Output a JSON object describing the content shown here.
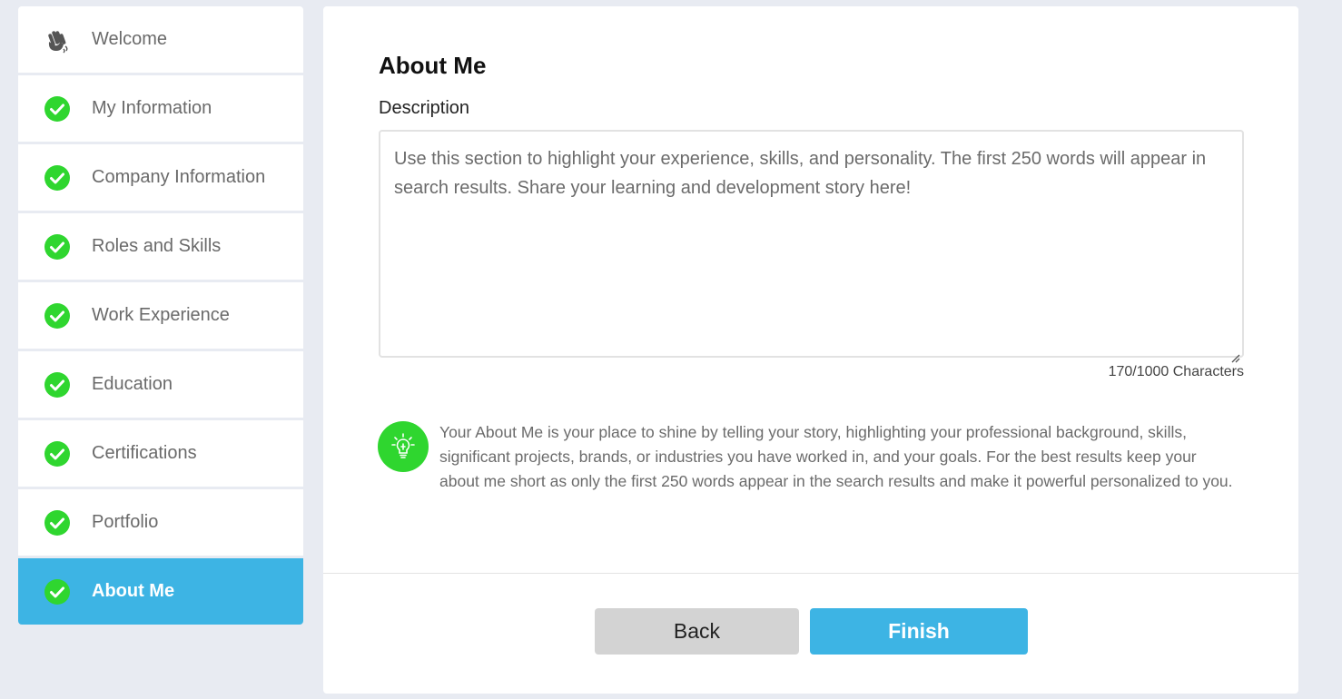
{
  "sidebar": {
    "items": [
      {
        "label": "Welcome",
        "icon": "wave-hand-icon",
        "state": "default"
      },
      {
        "label": "My Information",
        "icon": "check-circle-icon",
        "state": "complete"
      },
      {
        "label": "Company Information",
        "icon": "check-circle-icon",
        "state": "complete"
      },
      {
        "label": "Roles and Skills",
        "icon": "check-circle-icon",
        "state": "complete"
      },
      {
        "label": "Work Experience",
        "icon": "check-circle-icon",
        "state": "complete"
      },
      {
        "label": "Education",
        "icon": "check-circle-icon",
        "state": "complete"
      },
      {
        "label": "Certifications",
        "icon": "check-circle-icon",
        "state": "complete"
      },
      {
        "label": "Portfolio",
        "icon": "check-circle-icon",
        "state": "complete"
      },
      {
        "label": "About Me",
        "icon": "check-circle-icon",
        "state": "active"
      }
    ]
  },
  "main": {
    "title": "About Me",
    "description_label": "Description",
    "description_value": "Use this section to highlight your experience, skills, and personality. The first 250 words will appear in search results. Share your learning and development story here!",
    "char_count": "170/1000 Characters",
    "tip_icon": "lightbulb-icon",
    "tip_text": "Your About Me is your place to shine by telling your story, highlighting your professional background, skills, significant projects, brands, or industries you have worked in, and your goals. For the best results keep your about me short as only the first 250 words appear in the search results and make it powerful personalized to you."
  },
  "footer": {
    "back_label": "Back",
    "finish_label": "Finish"
  },
  "colors": {
    "accent": "#3db4e4",
    "check_green": "#2fd62f",
    "background": "#e8ebf2"
  }
}
